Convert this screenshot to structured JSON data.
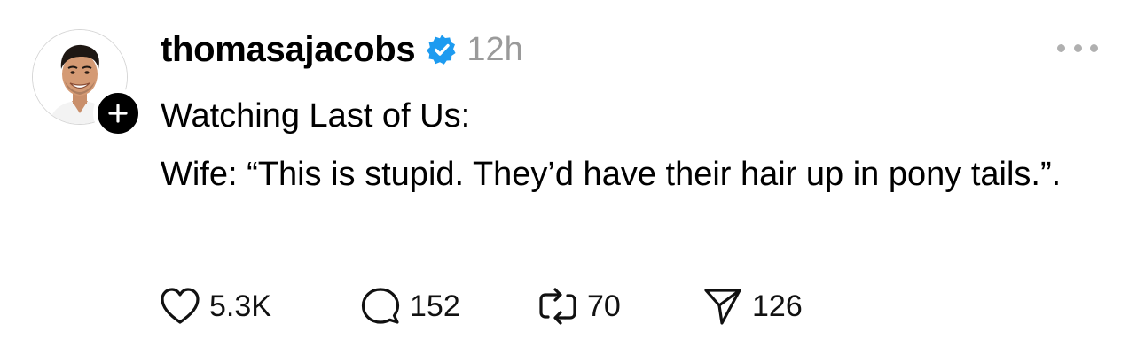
{
  "post": {
    "username": "thomasajacobs",
    "time": "12h",
    "text_line_1": "Watching Last of Us:",
    "text_line_2": "Wife: “This is stupid. They’d have their hair up in pony tails.”."
  },
  "stats": {
    "likes": "5.3K",
    "replies": "152",
    "reposts": "70",
    "shares": "126"
  },
  "icons": {
    "verified": "verified-badge-icon",
    "follow": "plus-icon",
    "more": "more-horizontal-icon",
    "like": "heart-icon",
    "reply": "speech-bubble-icon",
    "repost": "repost-icon",
    "share": "paper-plane-icon"
  },
  "colors": {
    "verified": "#1d9bf0",
    "timestamp": "#9a9a9a",
    "text": "#000000"
  }
}
